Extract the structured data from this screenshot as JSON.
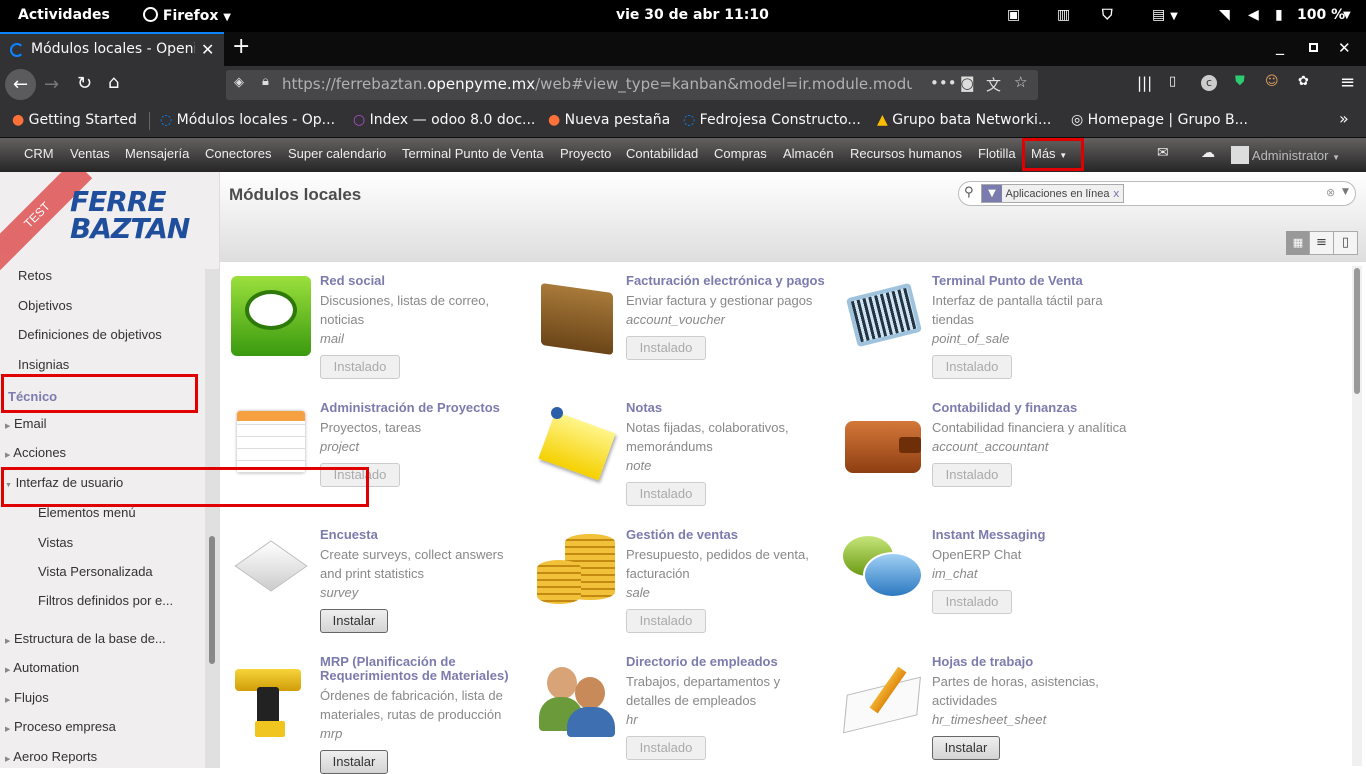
{
  "gnome": {
    "activities": "Actividades",
    "app": "Firefox",
    "clock": "vie 30 de abr  11:10",
    "battery": "100 %"
  },
  "tab": {
    "title": "Módulos locales - Openi"
  },
  "url": {
    "prefix": "https://ferrebaztan.",
    "domain": "openpyme.mx",
    "path": "/web#view_type=kanban&model=ir.module.module&m"
  },
  "bookmarks": [
    "Getting Started",
    "Módulos locales - Op...",
    "Index — odoo 8.0 doc...",
    "Nueva pestaña",
    "Fedrojesa Constructo...",
    "Grupo bata Networki...",
    "Homepage | Grupo B..."
  ],
  "odoo_menu": [
    "CRM",
    "Ventas",
    "Mensajería",
    "Conectores",
    "Super calendario",
    "Terminal Punto de Venta",
    "Proyecto",
    "Contabilidad",
    "Compras",
    "Almacén",
    "Recursos humanos",
    "Flotilla",
    "Más"
  ],
  "user": "Administrator",
  "logo": {
    "line1": "FERRE",
    "line2": "BAZTAN",
    "ribbon": "TEST"
  },
  "sidebar": {
    "top_items": [
      "Retos",
      "Objetivos",
      "Definiciones de objetivos",
      "Insignias"
    ],
    "section": "Técnico",
    "tree": [
      "Email",
      "Acciones",
      "Interfaz de usuario"
    ],
    "sub": [
      "Elementos menú",
      "Vistas",
      "Vista Personalizada",
      "Filtros definidos por e..."
    ],
    "more": [
      "Estructura de la base de...",
      "Automation",
      "Flujos",
      "Proceso empresa",
      "Aeroo Reports"
    ]
  },
  "page_title": "Módulos locales",
  "search": {
    "facet": "Aplicaciones en línea"
  },
  "modules": [
    {
      "name": "Red social",
      "desc": "Discusiones, listas de correo, noticias",
      "tech": "mail",
      "btn": "Instalado"
    },
    {
      "name": "Facturación electrónica y pagos",
      "desc": "Enviar factura y gestionar pagos",
      "tech": "account_voucher",
      "btn": "Instalado"
    },
    {
      "name": "Terminal Punto de Venta",
      "desc": "Interfaz de pantalla táctil para tiendas",
      "tech": "point_of_sale",
      "btn": "Instalado"
    },
    {
      "name": "Administración de Proyectos",
      "desc": "Proyectos, tareas",
      "tech": "project",
      "btn": "Instalado"
    },
    {
      "name": "Notas",
      "desc": "Notas fijadas, colaborativos, memorándums",
      "tech": "note",
      "btn": "Instalado"
    },
    {
      "name": "Contabilidad y finanzas",
      "desc": "Contabilidad financiera y analítica",
      "tech": "account_accountant",
      "btn": "Instalado"
    },
    {
      "name": "Encuesta",
      "desc": "Create surveys, collect answers and print statistics",
      "tech": "survey",
      "btn": "Instalar"
    },
    {
      "name": "Gestión de ventas",
      "desc": "Presupuesto, pedidos de venta, facturación",
      "tech": "sale",
      "btn": "Instalado"
    },
    {
      "name": "Instant Messaging",
      "desc": "OpenERP Chat",
      "tech": "im_chat",
      "btn": "Instalado"
    },
    {
      "name": "MRP (Planificación de Requerimientos de Materiales)",
      "desc": "Órdenes de fabricación, lista de materiales, rutas de producción",
      "tech": "mrp",
      "btn": "Instalar"
    },
    {
      "name": "Directorio de empleados",
      "desc": "Trabajos, departamentos y detalles de empleados",
      "tech": "hr",
      "btn": "Instalado"
    },
    {
      "name": "Hojas de trabajo",
      "desc": "Partes de horas, asistencias, actividades",
      "tech": "hr_timesheet_sheet",
      "btn": "Instalar"
    }
  ]
}
